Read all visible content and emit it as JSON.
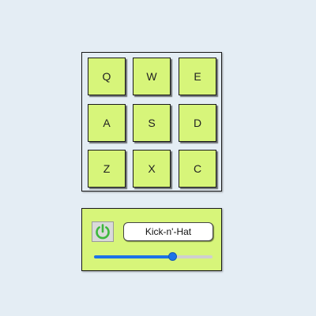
{
  "keypad": {
    "keys": [
      "Q",
      "W",
      "E",
      "A",
      "S",
      "D",
      "Z",
      "X",
      "C"
    ]
  },
  "controls": {
    "power_icon": "power-icon",
    "sound_name": "Kick-n'-Hat",
    "volume": 0.66
  },
  "colors": {
    "background": "#e4edf4",
    "key_fill": "#d7f57a",
    "power_green": "#3db83d",
    "slider_blue": "#1d72e8"
  }
}
